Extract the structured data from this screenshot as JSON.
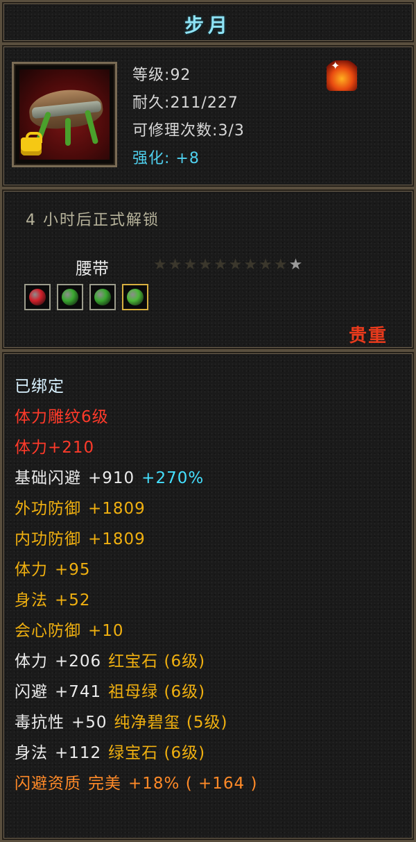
{
  "title": "步月",
  "header": {
    "stats": [
      {
        "label": "等级",
        "value": "92"
      },
      {
        "label": "耐久",
        "value": "211/227"
      },
      {
        "label": "可修理次数",
        "value": "3/3"
      }
    ],
    "enhance": {
      "label": "强化:",
      "value": "+8"
    },
    "icons": {
      "item": "belt-icon",
      "lock": "lock-icon",
      "gem": "fire-gem-icon"
    }
  },
  "mid": {
    "unlock_text": "4 小时后正式解锁",
    "item_type": "腰带",
    "stars": {
      "total": 10,
      "lit": 1
    },
    "sockets": [
      {
        "name": "ruby-socket-icon",
        "color": "#d2202a"
      },
      {
        "name": "emerald-socket-icon",
        "color": "#3aa830"
      },
      {
        "name": "emerald-socket-icon",
        "color": "#3aa830"
      },
      {
        "name": "jade-socket-icon",
        "color": "#4cb838"
      }
    ],
    "rarity": "贵重"
  },
  "attributes": [
    {
      "parts": [
        {
          "text": "已绑定",
          "color": "#d9f2ff"
        }
      ]
    },
    {
      "parts": [
        {
          "text": "体力雕纹6级",
          "color": "#ff3a2a"
        }
      ]
    },
    {
      "parts": [
        {
          "text": "体力+210",
          "color": "#ff3a2a"
        }
      ]
    },
    {
      "parts": [
        {
          "text": "基础闪避",
          "color": "#ececec"
        },
        {
          "text": "+910",
          "color": "#ececec"
        },
        {
          "text": "+270%",
          "color": "#45e0ff"
        }
      ]
    },
    {
      "parts": [
        {
          "text": "外功防御",
          "color": "#f0b010"
        },
        {
          "text": "+1809",
          "color": "#f0b010"
        }
      ]
    },
    {
      "parts": [
        {
          "text": "内功防御",
          "color": "#f0b010"
        },
        {
          "text": "+1809",
          "color": "#f0b010"
        }
      ]
    },
    {
      "parts": [
        {
          "text": "体力",
          "color": "#f0b010"
        },
        {
          "text": "+95",
          "color": "#f0b010"
        }
      ]
    },
    {
      "parts": [
        {
          "text": "身法",
          "color": "#f0b010"
        },
        {
          "text": "+52",
          "color": "#f0b010"
        }
      ]
    },
    {
      "parts": [
        {
          "text": "会心防御",
          "color": "#f0b010"
        },
        {
          "text": "+10",
          "color": "#f0b010"
        }
      ]
    },
    {
      "parts": [
        {
          "text": "体力",
          "color": "#ececec"
        },
        {
          "text": "+206",
          "color": "#ececec"
        },
        {
          "text": "红宝石 (6级)",
          "color": "#f0b010"
        }
      ]
    },
    {
      "parts": [
        {
          "text": "闪避",
          "color": "#ececec"
        },
        {
          "text": "+741",
          "color": "#ececec"
        },
        {
          "text": "祖母绿 (6级)",
          "color": "#f0b010"
        }
      ]
    },
    {
      "parts": [
        {
          "text": "毒抗性",
          "color": "#ececec"
        },
        {
          "text": "+50",
          "color": "#ececec"
        },
        {
          "text": "纯净碧玺 (5级)",
          "color": "#f0b010"
        }
      ]
    },
    {
      "parts": [
        {
          "text": "身法",
          "color": "#ececec"
        },
        {
          "text": "+112",
          "color": "#ececec"
        },
        {
          "text": "绿宝石 (6级)",
          "color": "#f0b010"
        }
      ]
    },
    {
      "parts": [
        {
          "text": "闪避资质",
          "color": "#ff8a28"
        },
        {
          "text": "完美",
          "color": "#ff8a28"
        },
        {
          "text": "+18% ( +164 )",
          "color": "#ff8a28"
        }
      ]
    }
  ]
}
